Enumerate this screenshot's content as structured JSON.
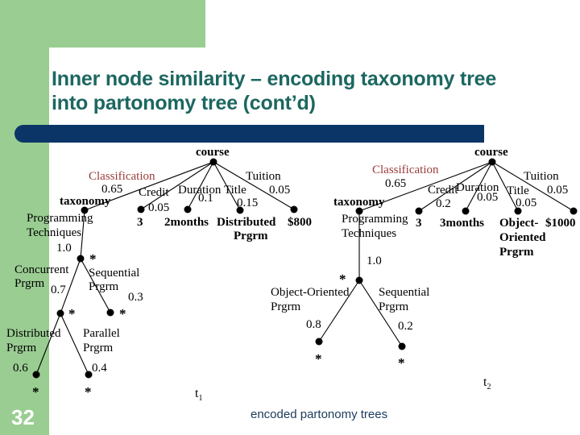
{
  "slide": {
    "title": "Inner node similarity – encoding taxonomy tree into partonomy tree (cont’d)",
    "page_number": "32",
    "caption": "encoded partonomy trees",
    "colors": {
      "accent_green": "#9acd92",
      "title_teal": "#1c6760",
      "bar_blue": "#0b3566",
      "classification_red": "#9a3b3b",
      "caption_blue": "#1b3a5c"
    }
  },
  "tree_left": {
    "name": "t1",
    "root": "course",
    "root_children": [
      {
        "edge": "Classification",
        "weight": "0.65",
        "node": "taxonomy"
      },
      {
        "edge": "Credit",
        "weight": "0.05",
        "node": "3"
      },
      {
        "edge": "Duration",
        "weight": "0.1",
        "node": "2months"
      },
      {
        "edge": "Title",
        "weight": "0.15",
        "node": "Distributed Prgrm"
      },
      {
        "edge": "Tuition",
        "weight": "0.05",
        "node": "$800"
      }
    ],
    "taxonomy_chain": [
      {
        "edge": "Programming Techniques",
        "weight": "1.0",
        "node": "*"
      }
    ],
    "level2": [
      {
        "edge": "Concurrent Prgrm",
        "weight": "0.7",
        "node": "*"
      },
      {
        "edge": "Sequential Prgrm",
        "weight": "0.3",
        "node": "*"
      }
    ],
    "level3": [
      {
        "edge": "Distributed Prgrm",
        "weight": "0.6",
        "node": "*"
      },
      {
        "edge": "Parallel Prgrm",
        "weight": "0.4",
        "node": "*"
      }
    ]
  },
  "tree_right": {
    "name": "t2",
    "root": "course",
    "root_children": [
      {
        "edge": "Classification",
        "weight": "0.65",
        "node": "taxonomy"
      },
      {
        "edge": "Credit",
        "weight": "0.2",
        "node": "3"
      },
      {
        "edge": "Duration",
        "weight": "0.05",
        "node": "3months"
      },
      {
        "edge": "Title",
        "weight": "0.05",
        "node": "Object- Oriented Prgrm"
      },
      {
        "edge": "Tuition",
        "weight": "0.05",
        "node": "$1000"
      }
    ],
    "taxonomy_chain": [
      {
        "edge": "Programming Techniques",
        "weight": "1.0",
        "node": "*"
      }
    ],
    "level2": [
      {
        "edge": "Object-Oriented Prgrm",
        "weight": "0.8",
        "node": "*"
      },
      {
        "edge": "Sequential Prgrm",
        "weight": "0.2",
        "node": "*"
      }
    ]
  },
  "labels": {
    "t1": "t",
    "t1_sub": "1",
    "t2": "t",
    "t2_sub": "2",
    "course_left": "course",
    "course_right": "course",
    "classification_left": "Classification",
    "classification_right": "Classification",
    "w_classification_left": "0.65",
    "w_classification_right": "0.65",
    "taxonomy_left": "taxonomy",
    "taxonomy_right": "taxonomy",
    "credit_left": "Credit",
    "credit_right": "Credit",
    "w_credit_left": "0.05",
    "w_credit_right": "0.2",
    "duration_left": "Duration",
    "duration_right": "Duration",
    "w_duration_left": "0.1",
    "w_duration_right": "0.05",
    "title_left": "Title",
    "title_right": "Title",
    "w_title_left": "0.15",
    "w_title_right": "0.05",
    "tuition_left": "Tuition",
    "tuition_right": "Tuition",
    "w_tuition_left": "0.05",
    "w_tuition_right": "0.05",
    "leaf_credit_left": "3",
    "leaf_credit_right": "3",
    "leaf_duration_left": "2months",
    "leaf_duration_right": "3months",
    "leaf_title_left_1": "Distributed",
    "leaf_title_left_2": "Prgrm",
    "leaf_title_right_1": "Object-",
    "leaf_title_right_2": "Oriented",
    "leaf_title_right_3": "Prgrm",
    "leaf_tuition_left": "$800",
    "leaf_tuition_right": "$1000",
    "prog_tech_left_1": "Programming",
    "prog_tech_left_2": "Techniques",
    "prog_tech_right_1": "Programming",
    "prog_tech_right_2": "Techniques",
    "w_prog_left": "1.0",
    "w_prog_right": "1.0",
    "star": "*",
    "concurrent_1": "Concurrent",
    "concurrent_2": "Prgrm",
    "w_concurrent": "0.7",
    "sequential_left_1": "Sequential",
    "sequential_left_2": "Prgrm",
    "w_sequential_left": "0.3",
    "distributed_1": "Distributed",
    "distributed_2": "Prgrm",
    "w_distributed": "0.6",
    "parallel_1": "Parallel",
    "parallel_2": "Prgrm",
    "w_parallel": "0.4",
    "oo_right_1": "Object-Oriented",
    "oo_right_2": "Prgrm",
    "w_oo_right": "0.8",
    "sequential_right_1": "Sequential",
    "sequential_right_2": "Prgrm",
    "w_sequential_right": "0.2"
  }
}
